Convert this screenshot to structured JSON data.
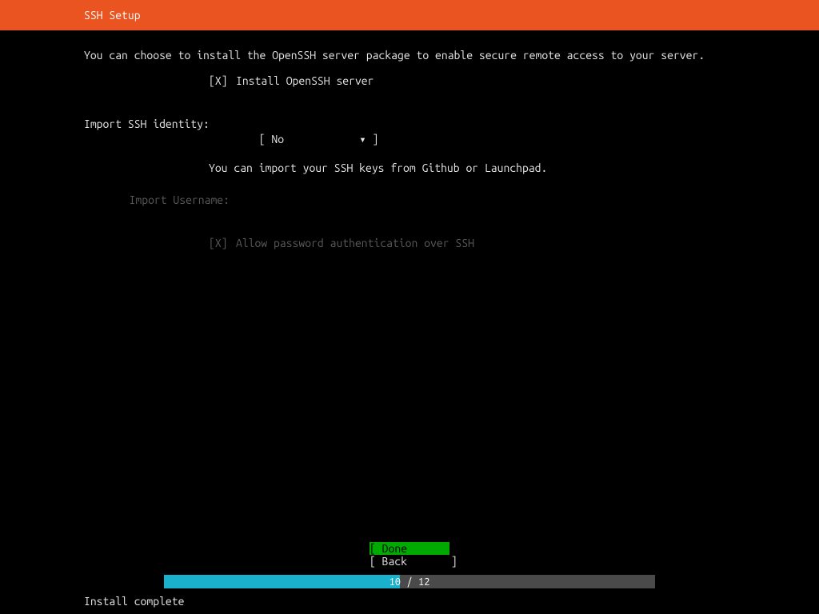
{
  "header": {
    "title": "SSH Setup"
  },
  "intro": "You can choose to install the OpenSSH server package to enable secure remote access to your server.",
  "install": {
    "check": "[X]",
    "label": "Install OpenSSH server"
  },
  "identity": {
    "label": "Import SSH identity:",
    "bracket_open": "[ ",
    "value": "No",
    "arrow": "▾",
    "bracket_close": " ]",
    "help": "You can import your SSH keys from Github or Launchpad."
  },
  "username": {
    "label": "Import Username:",
    "value": ""
  },
  "allowpw": {
    "check": "[X]",
    "label": "Allow password authentication over SSH"
  },
  "buttons": {
    "done": "[ Done       ]",
    "back": "[ Back       ]"
  },
  "progress": {
    "text": "10 / 12",
    "percent": 48
  },
  "status": "Install complete"
}
